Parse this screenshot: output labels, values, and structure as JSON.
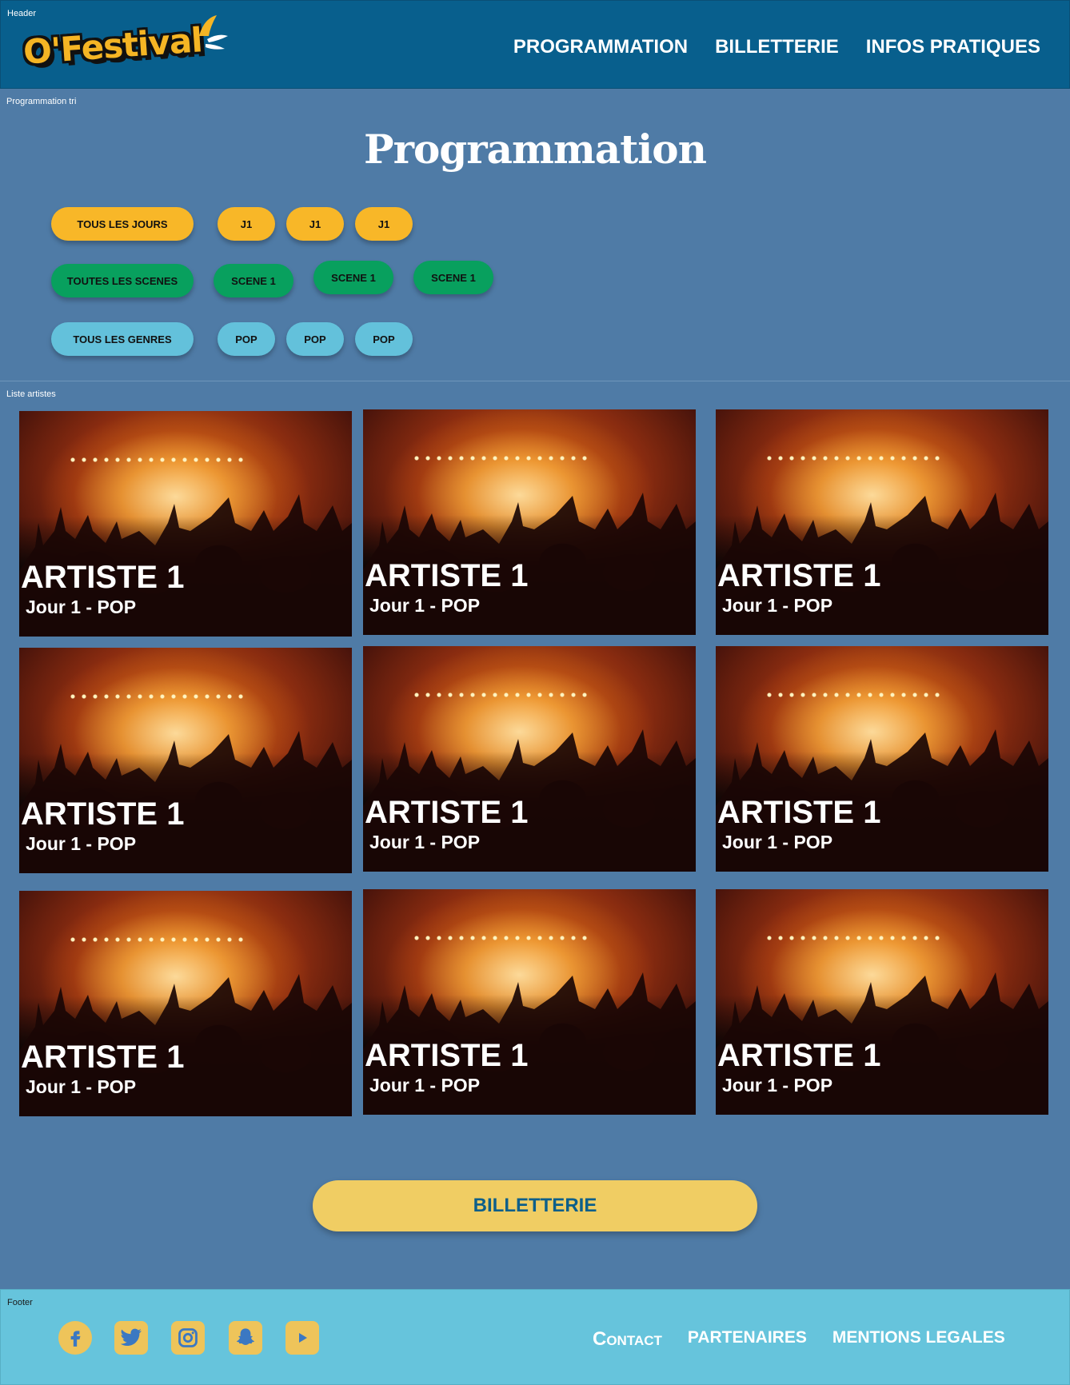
{
  "frames": {
    "header": "Header",
    "filters": "Programmation tri",
    "artists": "Liste artistes",
    "footer": "Footer"
  },
  "header": {
    "logo_text": "O'Festival",
    "nav": [
      "PROGRAMMATION",
      "BILLETTERIE",
      "INFOS PRATIQUES"
    ]
  },
  "filters": {
    "title": "Programmation",
    "days": [
      "TOUS LES JOURS",
      "J1",
      "J1",
      "J1"
    ],
    "scenes": [
      "TOUTES LES SCENES",
      "SCENE 1",
      "SCENE 1",
      "SCENE 1"
    ],
    "genres": [
      "TOUS LES GENRES",
      "POP",
      "POP",
      "POP"
    ]
  },
  "artists": [
    {
      "name": "ARTISTE 1",
      "sub": "Jour 1 - POP"
    },
    {
      "name": "ARTISTE 1",
      "sub": "Jour 1 - POP"
    },
    {
      "name": "ARTISTE 1",
      "sub": "Jour 1 - POP"
    },
    {
      "name": "ARTISTE 1",
      "sub": "Jour 1 - POP"
    },
    {
      "name": "ARTISTE 1",
      "sub": "Jour 1 - POP"
    },
    {
      "name": "ARTISTE 1",
      "sub": "Jour 1 - POP"
    },
    {
      "name": "ARTISTE 1",
      "sub": "Jour 1 - POP"
    },
    {
      "name": "ARTISTE 1",
      "sub": "Jour 1 - POP"
    },
    {
      "name": "ARTISTE 1",
      "sub": "Jour 1 - POP"
    }
  ],
  "cta": {
    "label": "BILLETTERIE"
  },
  "footer": {
    "social_icons": [
      "facebook-icon",
      "twitter-icon",
      "instagram-icon",
      "snapchat-icon",
      "youtube-icon"
    ],
    "links": [
      "Contact",
      "PARTENAIRES",
      "MENTIONS LEGALES"
    ]
  },
  "colors": {
    "header_bg": "#085f8d",
    "page_bg": "#4f7ba6",
    "footer_bg": "#66c4dc",
    "yellow_pill": "#f8b728",
    "green_pill": "#08a05e",
    "cyan_pill": "#63c1db",
    "cta_bg": "#f0cd63",
    "cta_text": "#0d5f8a"
  }
}
